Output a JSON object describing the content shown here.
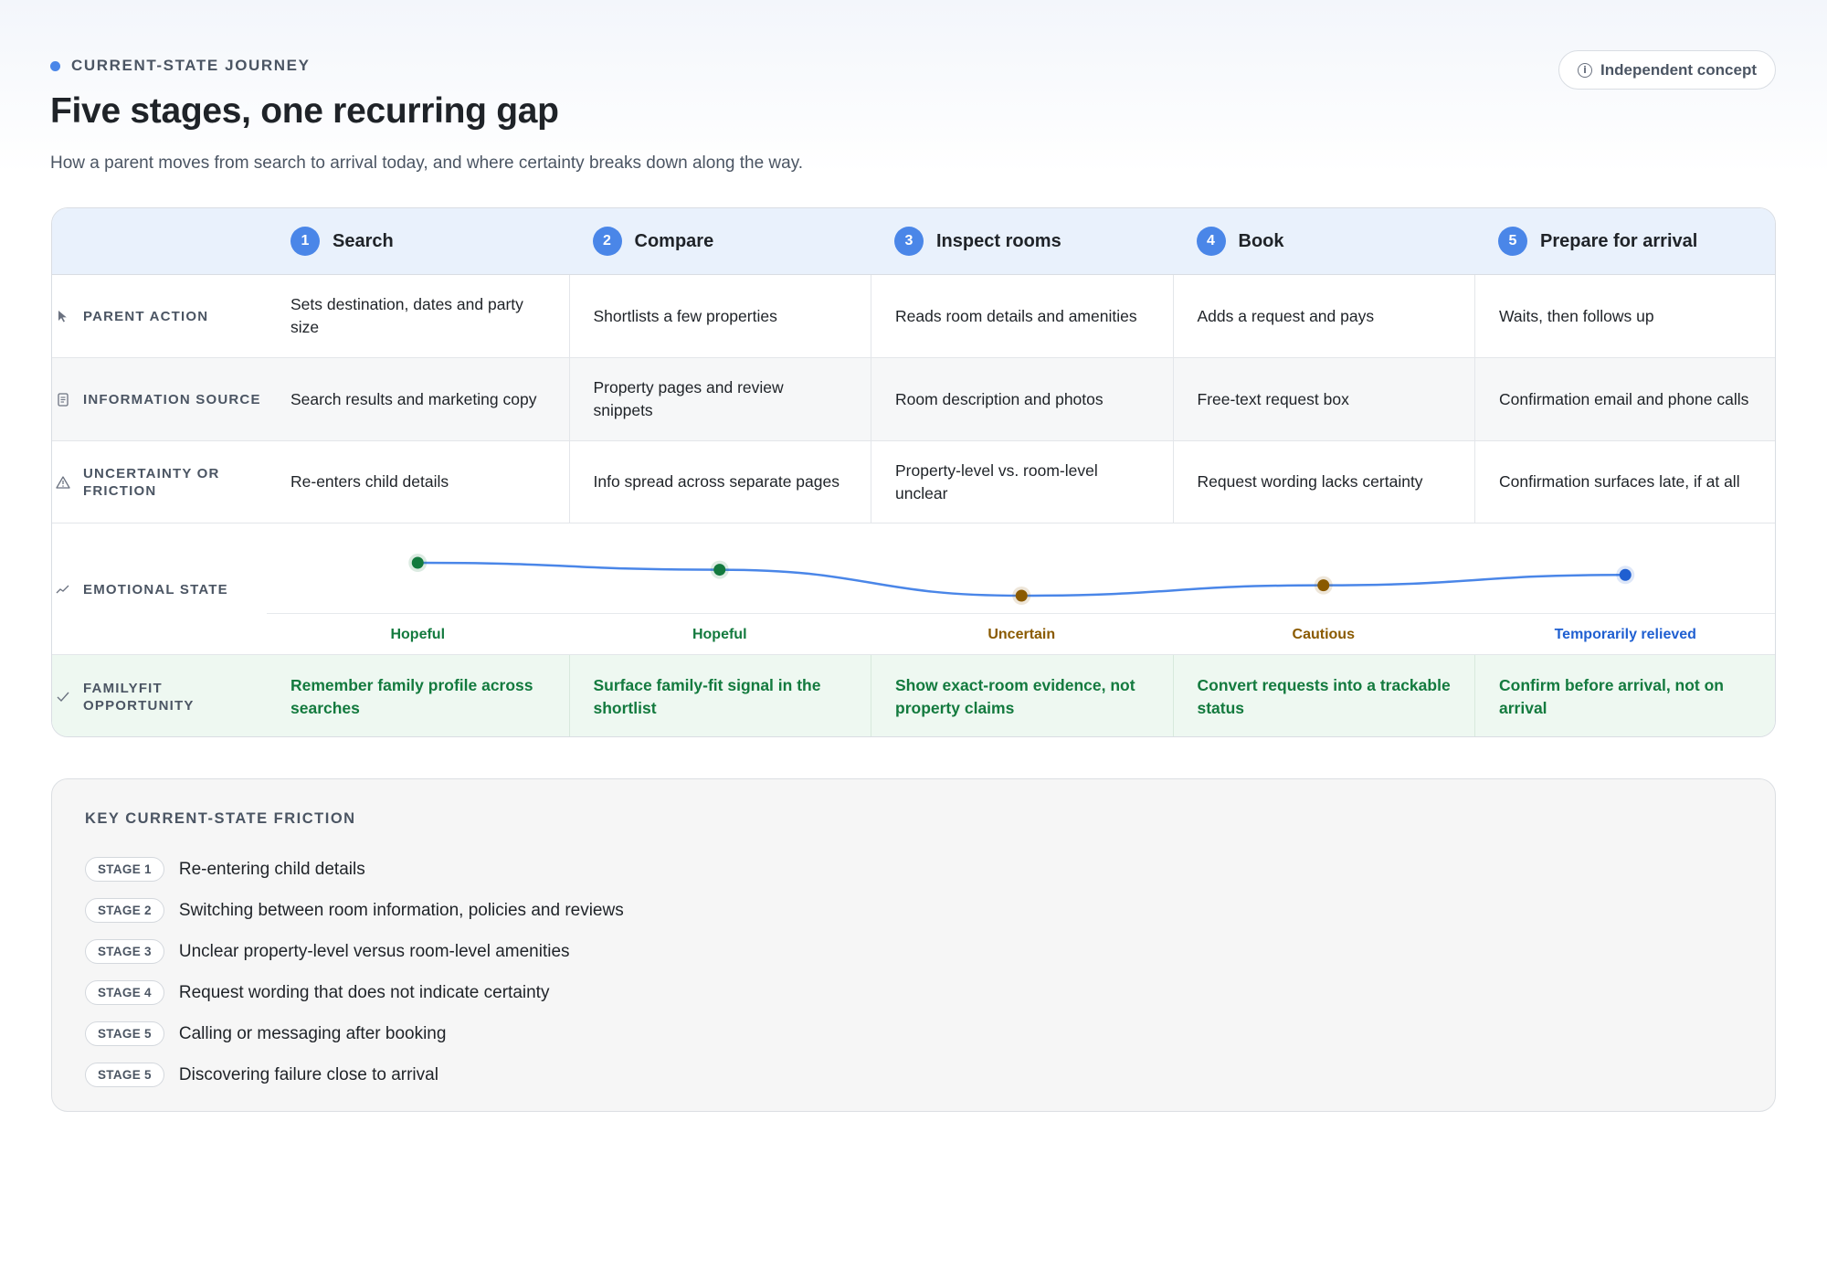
{
  "header": {
    "eyebrow": "CURRENT-STATE JOURNEY",
    "title": "Five stages, one recurring gap",
    "subtitle": "How a parent moves from search to arrival today, and where certainty breaks down along the way.",
    "badge": "Independent concept"
  },
  "stages": [
    {
      "num": "1",
      "name": "Search"
    },
    {
      "num": "2",
      "name": "Compare"
    },
    {
      "num": "3",
      "name": "Inspect rooms"
    },
    {
      "num": "4",
      "name": "Book"
    },
    {
      "num": "5",
      "name": "Prepare for arrival"
    }
  ],
  "rows": {
    "parent_action": {
      "label": "PARENT ACTION",
      "icon": "cursor-icon",
      "cells": [
        "Sets destination, dates and party size",
        "Shortlists a few properties",
        "Reads room details and amenities",
        "Adds a request and pays",
        "Waits, then follows up"
      ]
    },
    "information_source": {
      "label": "INFORMATION SOURCE",
      "icon": "document-icon",
      "cells": [
        "Search results and marketing copy",
        "Property pages and review snippets",
        "Room description and photos",
        "Free-text request box",
        "Confirmation email and phone calls"
      ]
    },
    "uncertainty": {
      "label": "UNCERTAINTY OR FRICTION",
      "icon": "warning-icon",
      "cells": [
        "Re-enters child details",
        "Info spread across separate pages",
        "Property-level vs. room-level unclear",
        "Request wording lacks certainty",
        "Confirmation surfaces late, if at all"
      ]
    },
    "emotional_state": {
      "label": "EMOTIONAL STATE",
      "icon": "trend-icon",
      "states": [
        {
          "label": "Hopeful",
          "level": 0.88,
          "color": "#137a3e"
        },
        {
          "label": "Hopeful",
          "level": 0.8,
          "color": "#137a3e"
        },
        {
          "label": "Uncertain",
          "level": 0.5,
          "color": "#8a5a00"
        },
        {
          "label": "Cautious",
          "level": 0.62,
          "color": "#8a5a00"
        },
        {
          "label": "Temporarily relieved",
          "level": 0.74,
          "color": "#1f5fd1"
        }
      ],
      "line_color": "#4a86e8"
    },
    "opportunity": {
      "label": "FAMILYFIT OPPORTUNITY",
      "icon": "check-icon",
      "cells": [
        "Remember family profile across searches",
        "Surface family-fit signal in the shortlist",
        "Show exact-room evidence, not property claims",
        "Convert requests into a trackable status",
        "Confirm before arrival, not on arrival"
      ]
    }
  },
  "friction": {
    "title": "KEY CURRENT-STATE FRICTION",
    "items": [
      {
        "stage": "STAGE 1",
        "text": "Re-entering child details"
      },
      {
        "stage": "STAGE 2",
        "text": "Switching between room information, policies and reviews"
      },
      {
        "stage": "STAGE 3",
        "text": "Unclear property-level versus room-level amenities"
      },
      {
        "stage": "STAGE 4",
        "text": "Request wording that does not indicate certainty"
      },
      {
        "stage": "STAGE 5",
        "text": "Calling or messaging after booking"
      },
      {
        "stage": "STAGE 5",
        "text": "Discovering failure close to arrival"
      }
    ]
  }
}
